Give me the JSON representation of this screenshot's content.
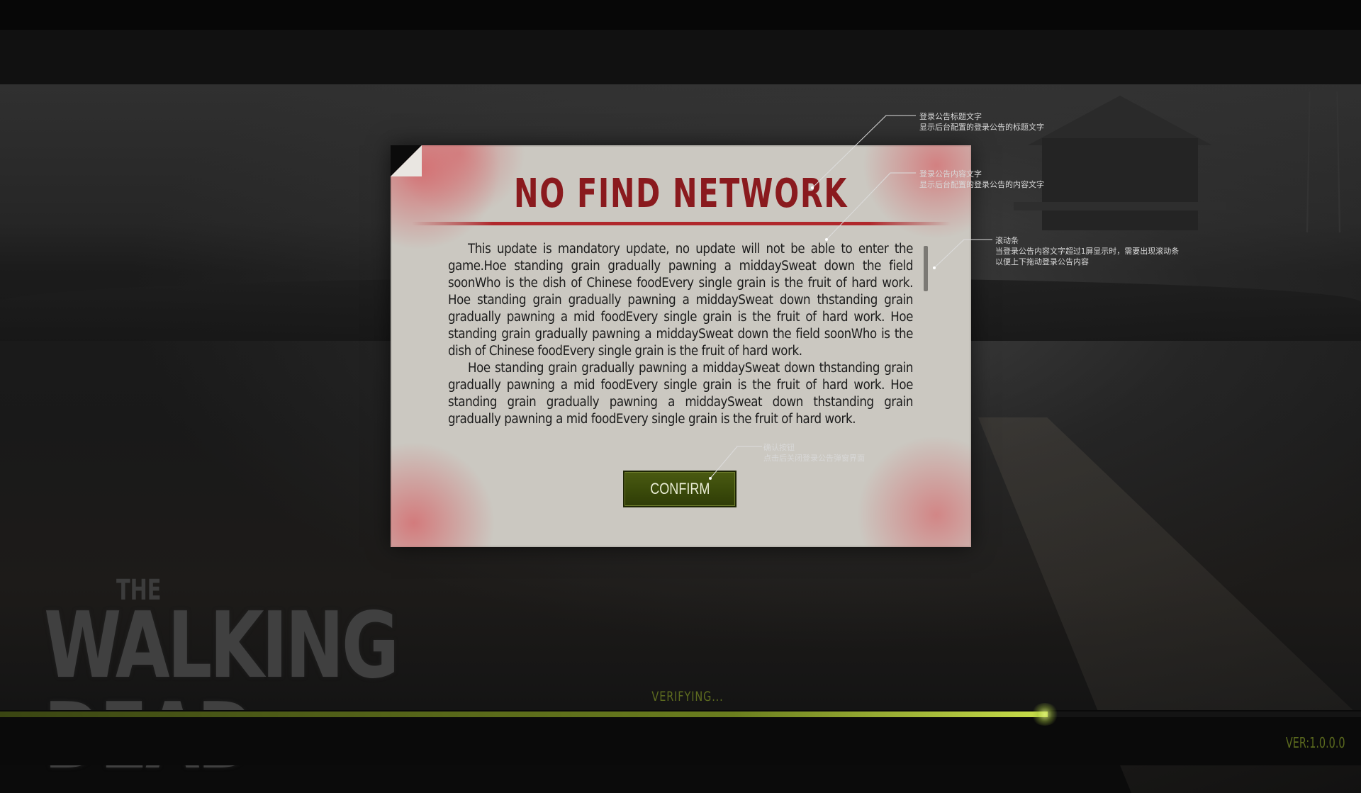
{
  "dialog": {
    "title": "NO FIND NETWORK",
    "paragraphs": [
      "This update is mandatory update, no update will not be able to enter the game.Hoe standing grain gradually pawning a middaySweat down the field soonWho is the dish of Chinese foodEvery single grain is the fruit of hard work.      Hoe standing grain gradually pawning a middaySweat down thstanding grain gradually pawning a mid foodEvery single grain is the fruit of hard work. Hoe standing grain gradually pawning a middaySweat down the field soonWho is the dish of Chinese foodEvery single grain is the fruit of hard work.",
      "Hoe standing grain gradually pawning a middaySweat down thstanding grain gradually pawning a mid foodEvery single grain is the fruit of hard work. Hoe standing grain gradually pawning a middaySweat down thstanding grain gradually pawning a mid foodEvery single grain is the fruit of hard work."
    ],
    "confirm_label": "CONFIRM"
  },
  "annotations": {
    "title": {
      "line1": "登录公告标题文字",
      "line2": "显示后台配置的登录公告的标题文字"
    },
    "content": {
      "line1": "登录公告内容文字",
      "line2": "显示后台配置的登录公告的内容文字"
    },
    "scrollbar": {
      "line1": "滚动条",
      "line2": "当登录公告内容文字超过1屏显示时，需要出现滚动条",
      "line3": "以便上下拖动登录公告内容"
    },
    "confirm": {
      "line1": "确认按钮",
      "line2": "点击后关闭登录公告弹窗界面"
    }
  },
  "logo": {
    "the": "THE",
    "title": "WALKING DEAD"
  },
  "status": {
    "verifying": "VERIFYING...",
    "progress_fraction": 0.77
  },
  "version": "VER:1.0.0.0",
  "colors": {
    "accent": "#6b7e1e",
    "title_red": "#8a1a1e",
    "dialog_bg": "#cbc8c1",
    "confirm_bg": "#3a4a0a"
  }
}
